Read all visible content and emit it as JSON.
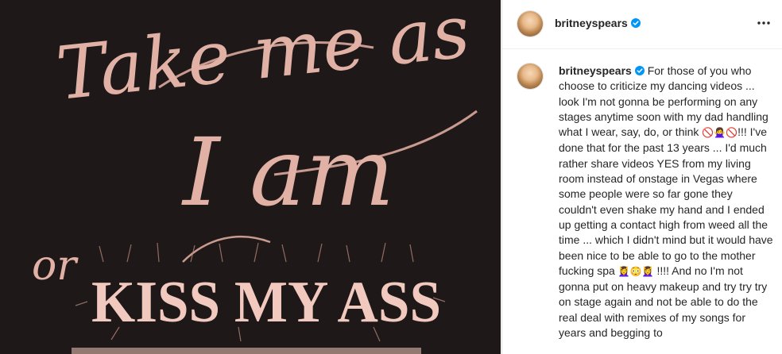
{
  "media": {
    "line1": "Take me as",
    "line2": "I am",
    "line3": "or",
    "line4": "KISS MY ASS"
  },
  "post": {
    "username": "britneyspears",
    "verified_icon": "verified-badge-icon",
    "more_icon": "more-options-icon"
  },
  "caption": {
    "username": "britneyspears",
    "text_a": "For those of you who choose to criticize my dancing videos ... look I'm not gonna be performing on any stages anytime soon with my dad handling what I wear, say, do, or think",
    "emoji_a": "🚫🙅‍♀️🚫",
    "text_b": "!!! I've done that for the past 13 years ... I'd much rather share videos YES from my living room instead of onstage in Vegas where some people were so far gone they couldn't even shake my hand and I ended up getting a contact high from weed all the time ... which I didn't mind but it would have been nice to be able to go to the mother fucking spa",
    "emoji_b": "💆‍♀️😳💆‍♀️",
    "text_c": "!!!! And no I'm not gonna put on heavy makeup and try try try on stage again and not be able to do the real deal with remixes of my songs for years and begging to"
  },
  "colors": {
    "background": "#1e1918",
    "script_pink": "#e2b1a5",
    "verified_blue": "#0095f6",
    "text": "#262626"
  }
}
